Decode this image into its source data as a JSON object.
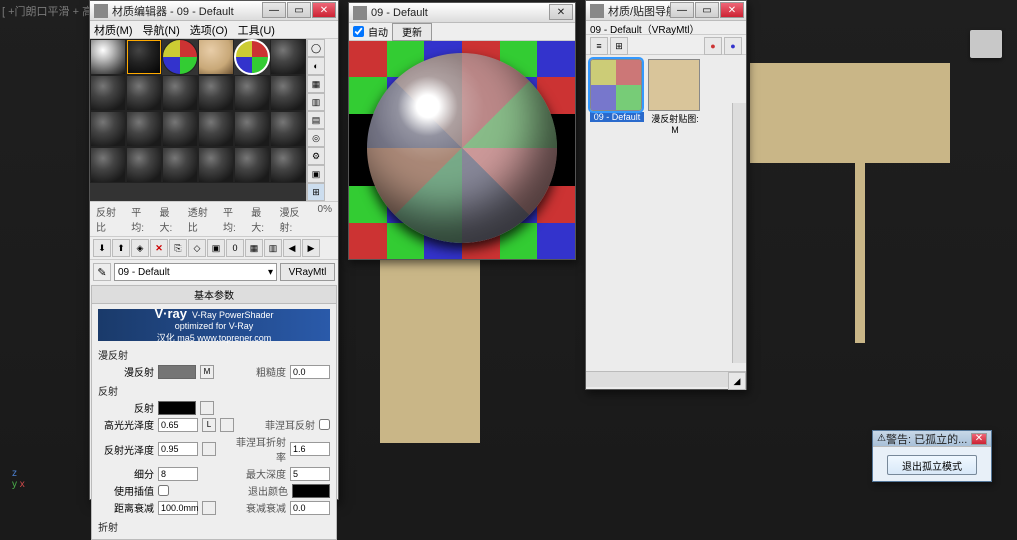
{
  "viewport": {
    "label": "[ +门朗口平滑 + 高",
    "axes": {
      "x": "x",
      "y": "y",
      "z": "z"
    }
  },
  "matEditor": {
    "title": "材质编辑器 - 09 - Default",
    "menu": {
      "modes": "材质(M)",
      "nav": "导航(N)",
      "options": "选项(O)",
      "utils": "工具(U)"
    },
    "stats": {
      "refl": "反射比",
      "avg": "平均:",
      "max": "最大:",
      "trans": "透射比",
      "avg2": "平均:",
      "max2": "最大:",
      "diff": "漫反射:",
      "pct": "0%"
    },
    "name": "09 - Default",
    "type": "VRayMtl",
    "rollBasic": "基本参数",
    "vray": {
      "brand": "V·ray",
      "line1": "V-Ray PowerShader",
      "line2": "optimized for V-Ray",
      "line3": "汉化 ma5 www.toprener.com"
    },
    "diffuse": {
      "section": "漫反射",
      "label": "漫反射",
      "rough": "粗糙度",
      "roughVal": "0.0"
    },
    "reflect": {
      "section": "反射",
      "label": "反射",
      "hilight": "高光光泽度",
      "hilightVal": "0.65",
      "L": "L",
      "glossy": "反射光泽度",
      "glossyVal": "0.95",
      "fresnel": "菲涅耳反射",
      "fresnelIOR": "菲涅耳折射率",
      "fresnelIORVal": "1.6",
      "subdiv": "细分",
      "subdivVal": "8",
      "maxdepth": "最大深度",
      "maxdepthVal": "5",
      "useInter": "使用插值",
      "exitColor": "退出颜色",
      "dimDist": "距离衰减",
      "dimDistVal": "100.0mm",
      "dimFall": "衰减衰减",
      "dimFallVal": "0.0"
    },
    "refract": {
      "section": "折射"
    }
  },
  "preview": {
    "title": "09 - Default",
    "auto": "自动",
    "update": "更新"
  },
  "navWin": {
    "title": "材质/贴图导航...",
    "sub": "09 - Default（VRayMtl）",
    "thumb1": "09 - Default",
    "thumb2": "漫反射贴图: M"
  },
  "warn": {
    "title": "警告: 已孤立的...",
    "btn": "退出孤立模式"
  }
}
